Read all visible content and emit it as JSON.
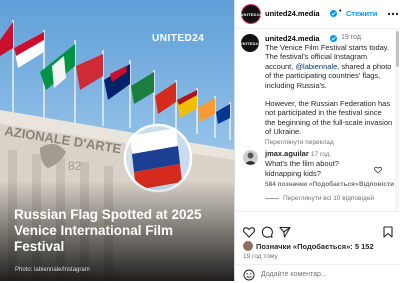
{
  "image": {
    "brand_watermark": "UNITED24",
    "building_sign": "AZIONALE D'ARTE C",
    "headline": "Russian Flag Spotted at 2025 Venice International Film Festival",
    "credit": "Photo: labiennale/Instagram"
  },
  "header": {
    "account": "united24.media",
    "follow_label": "Стежити",
    "avatar_text": "UNITED24",
    "more_icon": "more-icon"
  },
  "caption": {
    "account": "united24.media",
    "time": "19 год.",
    "text_before_mention": "The Venice Film Festival starts today. The festival's official Instagram account, ",
    "mention": "@labiennale",
    "text_after_mention": ", shared a photo of the participating countries' flags, including Russia's.",
    "text_paragraph2": "However, the Russian Federation has not participated in the festival since the beginning of the full-scale invasion of Ukraine.",
    "see_translation": "Переглянути переклад"
  },
  "comment": {
    "user": "jmax.aguilar",
    "time": "17 год.",
    "text": "What's the film about? kidnapping kids?",
    "likes": "584 позначки «Подобається»",
    "reply": "Відповісти",
    "view_replies": "Переглянути всі 10 відповідей"
  },
  "actions": {
    "likes_prefix": "Позначки «Подобається»: ",
    "likes_count": "5 152",
    "time": "19 год тому",
    "add_comment_placeholder": "Додайте коментар..."
  },
  "colors": {
    "accent": "#0095f6",
    "mention": "#00376b",
    "secondary_text": "#737373",
    "verified": "#0095f6"
  }
}
